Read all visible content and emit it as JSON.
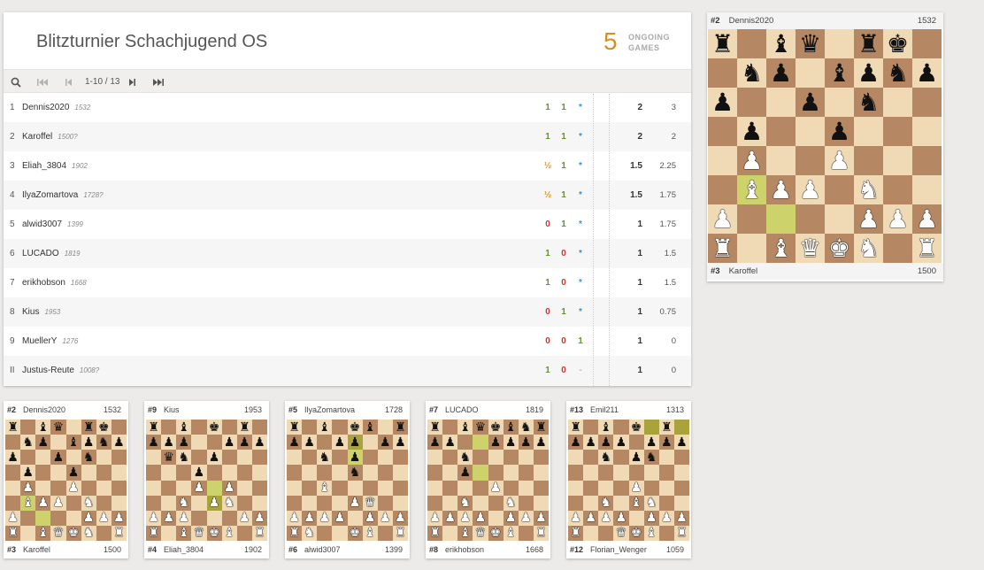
{
  "tournament": {
    "title": "Blitzturnier Schachjugend OS",
    "ongoing_count": "5",
    "ongoing_label_1": "ONGOING",
    "ongoing_label_2": "GAMES"
  },
  "pager": {
    "page_info": "1-10 / 13"
  },
  "standings": [
    {
      "rank": "1",
      "name": "Dennis2020",
      "rating": "1532",
      "games": [
        [
          "1",
          "win"
        ],
        [
          "1",
          "win"
        ],
        [
          "*",
          "play"
        ]
      ],
      "points": "2",
      "tiebreak": "3"
    },
    {
      "rank": "2",
      "name": "Karoffel",
      "rating": "1500?",
      "games": [
        [
          "1",
          "win"
        ],
        [
          "1",
          "win"
        ],
        [
          "*",
          "play"
        ]
      ],
      "points": "2",
      "tiebreak": "2"
    },
    {
      "rank": "3",
      "name": "Eliah_3804",
      "rating": "1902",
      "games": [
        [
          "½",
          "draw"
        ],
        [
          "1",
          "win"
        ],
        [
          "*",
          "play"
        ]
      ],
      "points": "1.5",
      "tiebreak": "2.25"
    },
    {
      "rank": "4",
      "name": "IlyaZomartova",
      "rating": "1728?",
      "games": [
        [
          "½",
          "draw"
        ],
        [
          "1",
          "win"
        ],
        [
          "*",
          "play"
        ]
      ],
      "points": "1.5",
      "tiebreak": "1.75"
    },
    {
      "rank": "5",
      "name": "alwid3007",
      "rating": "1399",
      "games": [
        [
          "0",
          "loss"
        ],
        [
          "1",
          "win"
        ],
        [
          "*",
          "play"
        ]
      ],
      "points": "1",
      "tiebreak": "1.75"
    },
    {
      "rank": "6",
      "name": "LUCADO",
      "rating": "1819",
      "games": [
        [
          "1",
          "win"
        ],
        [
          "0",
          "loss"
        ],
        [
          "*",
          "play"
        ]
      ],
      "points": "1",
      "tiebreak": "1.5"
    },
    {
      "rank": "7",
      "name": "erikhobson",
      "rating": "1668",
      "games": [
        [
          "1",
          "win"
        ],
        [
          "0",
          "loss"
        ],
        [
          "*",
          "play"
        ]
      ],
      "points": "1",
      "tiebreak": "1.5"
    },
    {
      "rank": "8",
      "name": "Kius",
      "rating": "1953",
      "games": [
        [
          "0",
          "loss"
        ],
        [
          "1",
          "win"
        ],
        [
          "*",
          "play"
        ]
      ],
      "points": "1",
      "tiebreak": "0.75"
    },
    {
      "rank": "9",
      "name": "MuellerY",
      "rating": "1276",
      "games": [
        [
          "0",
          "loss"
        ],
        [
          "0",
          "loss"
        ],
        [
          "1",
          "win"
        ]
      ],
      "points": "1",
      "tiebreak": "0"
    },
    {
      "rank": "II",
      "name": "Justus-Reute",
      "rating": "1008?",
      "games": [
        [
          "1",
          "win"
        ],
        [
          "0",
          "loss"
        ],
        [
          "-",
          "dash"
        ]
      ],
      "points": "1",
      "tiebreak": "0"
    }
  ],
  "featured": {
    "top": {
      "rank": "#2",
      "name": "Dennis2020",
      "rating": "1532"
    },
    "bottom": {
      "rank": "#3",
      "name": "Karoffel",
      "rating": "1500"
    },
    "fen": "r1bq1rk1/1np1bpnp/p2p1n2/1p2p3/1P2P3/1BPP1N2/P4PPP/R1BQKN1R",
    "highlights": [
      "b3",
      "c2"
    ]
  },
  "games": [
    {
      "top": {
        "rank": "#2",
        "name": "Dennis2020",
        "rating": "1532"
      },
      "bottom": {
        "rank": "#3",
        "name": "Karoffel",
        "rating": "1500"
      },
      "fen": "r1bq1rk1/1np1bpnp/p2p1n2/1p2p3/1P2P3/1BPP1N2/P4PPP/R1BQKN1R",
      "highlights": [
        "b3",
        "c2"
      ]
    },
    {
      "top": {
        "rank": "#9",
        "name": "Kius",
        "rating": "1953"
      },
      "bottom": {
        "rank": "#4",
        "name": "Eliah_3804",
        "rating": "1902"
      },
      "fen": "r1b1k1r1/ppp2ppp/1qn1p3/3p4/3P1P2/2N1PN2/PPP3PP/R1BQKB1R",
      "highlights": [
        "e3",
        "e4"
      ]
    },
    {
      "top": {
        "rank": "#5",
        "name": "IlyaZomartova",
        "rating": "1728"
      },
      "bottom": {
        "rank": "#6",
        "name": "alwid3007",
        "rating": "1399"
      },
      "fen": "r1b1kb1r/pp1pp1pp/2n1p3/4n3/2B5/4PQ2/PPPP1PPP/RN2KB1R",
      "highlights": [
        "e7",
        "e6"
      ]
    },
    {
      "top": {
        "rank": "#7",
        "name": "LUCADO",
        "rating": "1819"
      },
      "bottom": {
        "rank": "#8",
        "name": "erikhobson",
        "rating": "1668"
      },
      "fen": "r1bqkbnr/pp2pppp/2n5/2p5/4P3/2N2N2/PPPP1PPP/R1BQKB1R",
      "highlights": [
        "d7",
        "d5"
      ]
    },
    {
      "top": {
        "rank": "#13",
        "name": "Emil211",
        "rating": "1313"
      },
      "bottom": {
        "rank": "#12",
        "name": "Florian_Wenger",
        "rating": "1059"
      },
      "fen": "r1b1k1r1/pppp1ppp/2n1pn2/8/4P3/2N1BN2/PPPP1PPP/R2QKB1R",
      "highlights": [
        "f8",
        "h8"
      ]
    }
  ],
  "icons": [
    "search-icon",
    "first-page-icon",
    "prev-page-icon",
    "next-page-icon",
    "last-page-icon"
  ],
  "colors": {
    "accent": "#d59020",
    "win": "#629924",
    "loss": "#cc3333",
    "playing": "#3692e7",
    "board_light": "#f0d9b5",
    "board_dark": "#b58863"
  }
}
